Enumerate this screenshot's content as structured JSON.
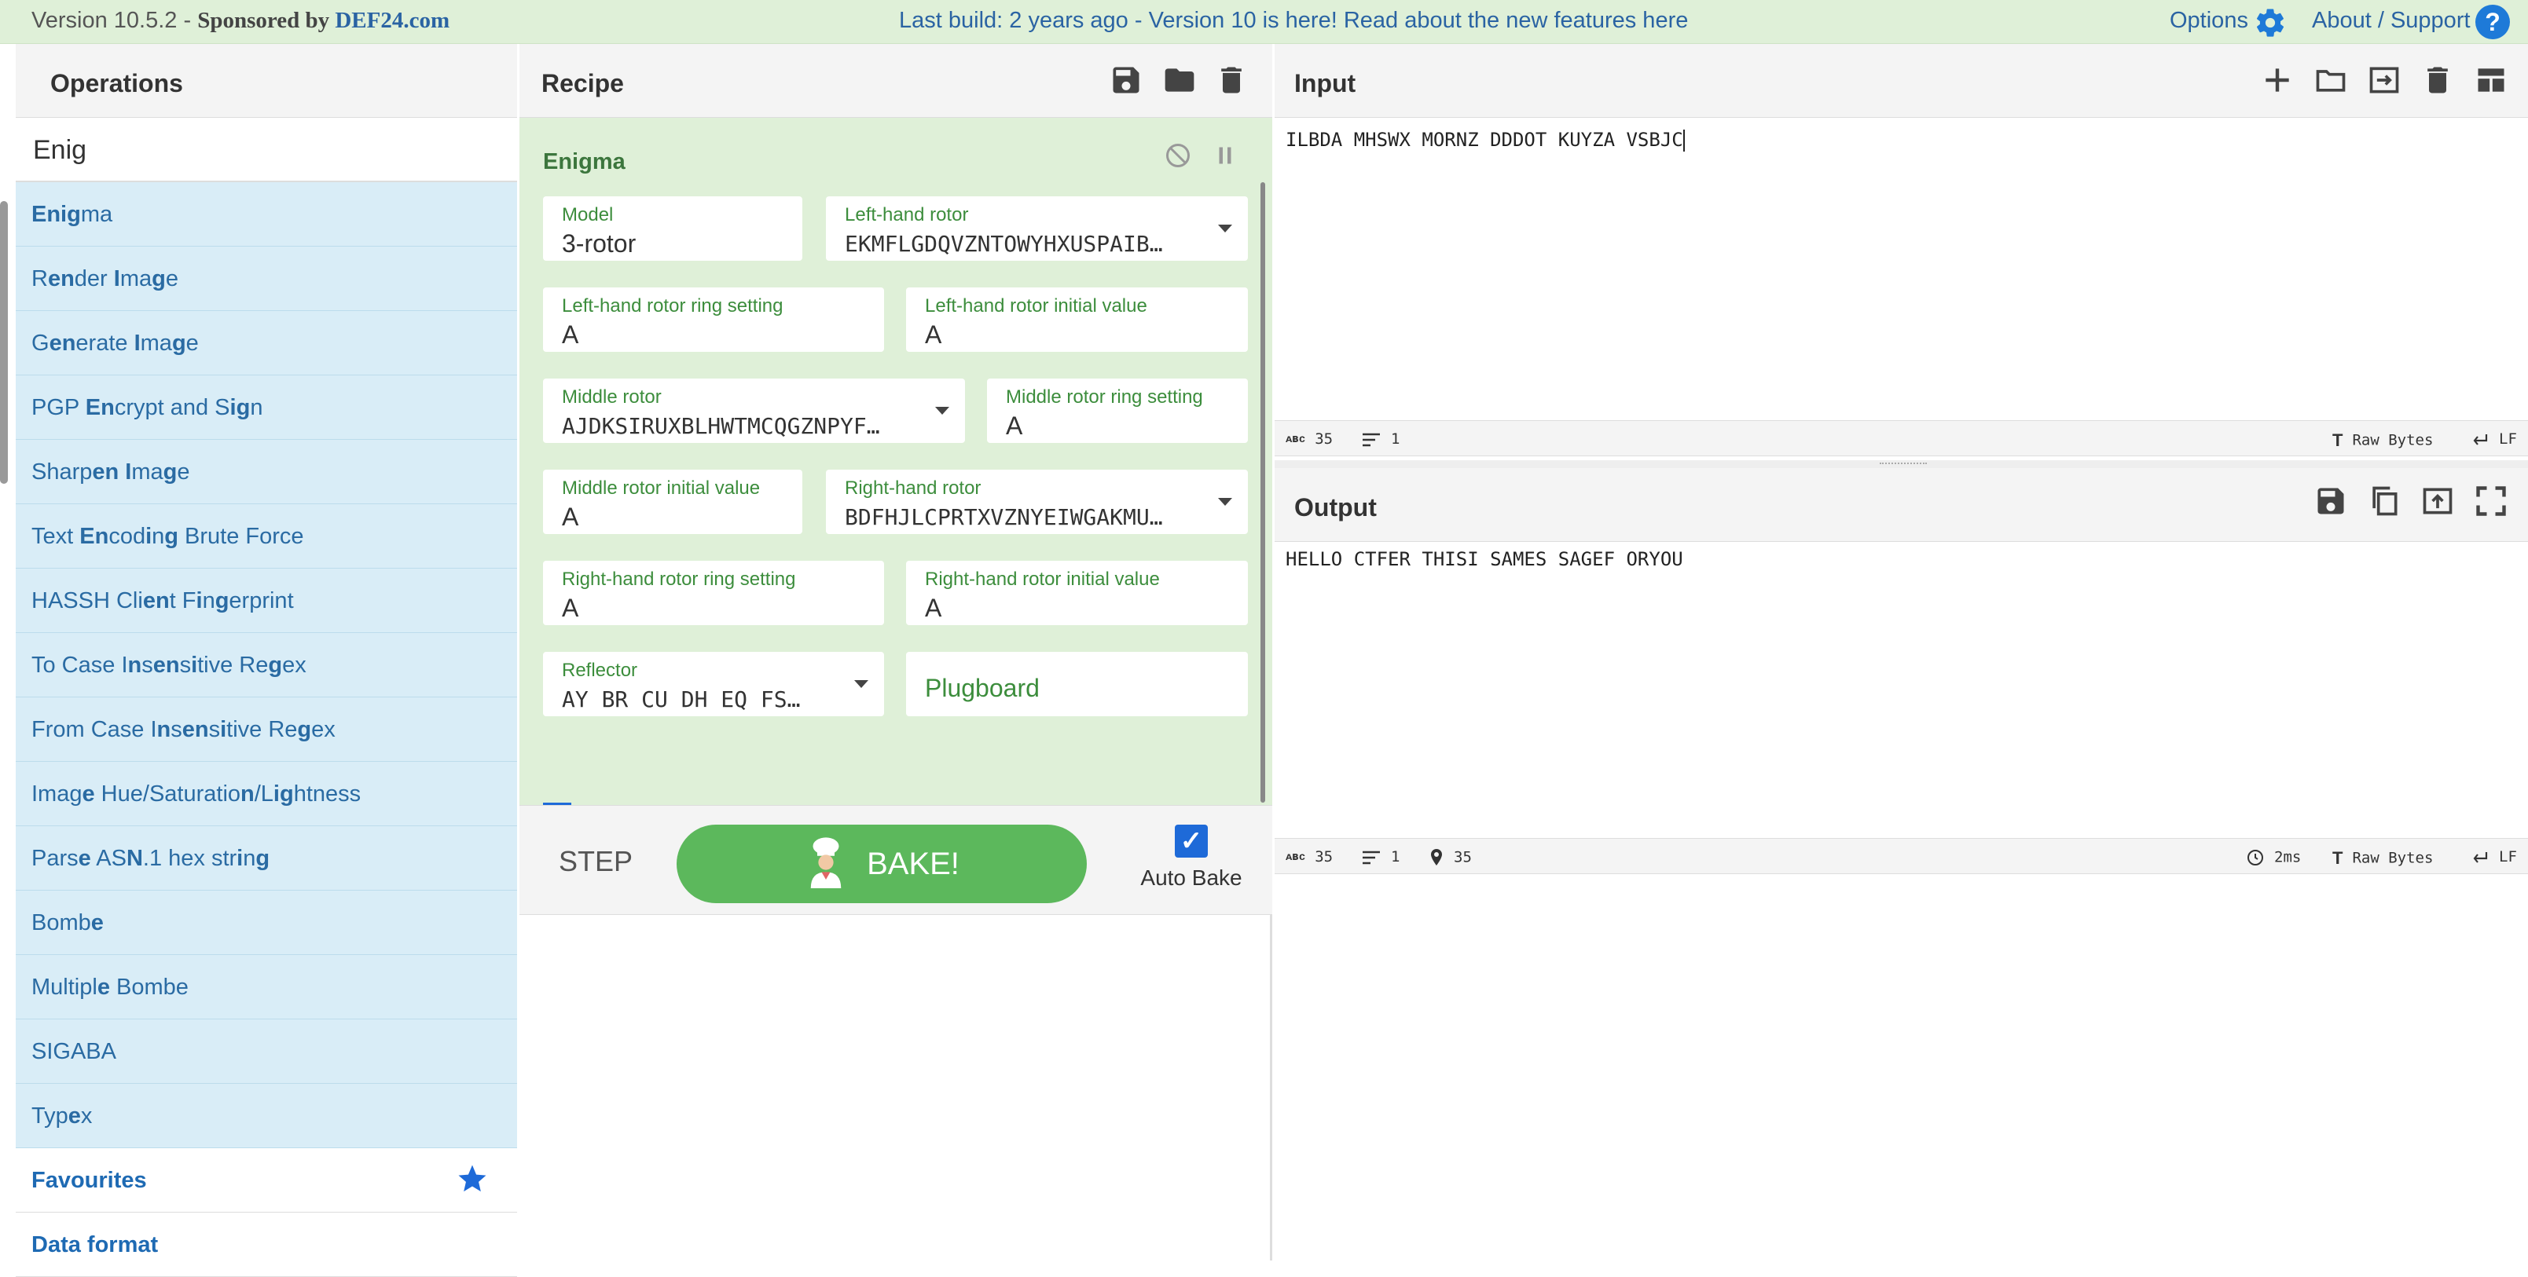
{
  "topbar": {
    "version": "Version 10.5.2 - ",
    "sponsored": "Sponsored",
    "by": " by ",
    "sponsor": "DEF24.com",
    "last_build": "Last build: 2 years ago - Version 10 is here! Read about the new features here",
    "options": "Options",
    "about": "About / Support",
    "help_icon": "?"
  },
  "operations": {
    "title": "Operations",
    "search_value": "Enig",
    "items": [
      {
        "parts": [
          {
            "t": "Enig",
            "b": true
          },
          {
            "t": "ma",
            "b": false
          }
        ]
      },
      {
        "parts": [
          {
            "t": "R",
            "b": false
          },
          {
            "t": "en",
            "b": true
          },
          {
            "t": "der ",
            "b": false
          },
          {
            "t": "I",
            "b": true
          },
          {
            "t": "ma",
            "b": false
          },
          {
            "t": "g",
            "b": true
          },
          {
            "t": "e",
            "b": false
          }
        ]
      },
      {
        "parts": [
          {
            "t": "G",
            "b": false
          },
          {
            "t": "en",
            "b": true
          },
          {
            "t": "erate ",
            "b": false
          },
          {
            "t": "I",
            "b": true
          },
          {
            "t": "ma",
            "b": false
          },
          {
            "t": "g",
            "b": true
          },
          {
            "t": "e",
            "b": false
          }
        ]
      },
      {
        "parts": [
          {
            "t": "PGP ",
            "b": false
          },
          {
            "t": "En",
            "b": true
          },
          {
            "t": "crypt and S",
            "b": false
          },
          {
            "t": "ig",
            "b": true
          },
          {
            "t": "n",
            "b": false
          }
        ]
      },
      {
        "parts": [
          {
            "t": "Sharp",
            "b": false
          },
          {
            "t": "en",
            "b": true
          },
          {
            "t": " ",
            "b": false
          },
          {
            "t": "I",
            "b": true
          },
          {
            "t": "ma",
            "b": false
          },
          {
            "t": "g",
            "b": true
          },
          {
            "t": "e",
            "b": false
          }
        ]
      },
      {
        "parts": [
          {
            "t": "Text ",
            "b": false
          },
          {
            "t": "En",
            "b": true
          },
          {
            "t": "cod",
            "b": false
          },
          {
            "t": "i",
            "b": true
          },
          {
            "t": "n",
            "b": false
          },
          {
            "t": "g",
            "b": true
          },
          {
            "t": " Brute Force",
            "b": false
          }
        ]
      },
      {
        "parts": [
          {
            "t": "HASSH Cli",
            "b": false
          },
          {
            "t": "en",
            "b": true
          },
          {
            "t": "t F",
            "b": false
          },
          {
            "t": "i",
            "b": true
          },
          {
            "t": "n",
            "b": false
          },
          {
            "t": "g",
            "b": true
          },
          {
            "t": "erprint",
            "b": false
          }
        ]
      },
      {
        "parts": [
          {
            "t": "To Case I",
            "b": false
          },
          {
            "t": "n",
            "b": true
          },
          {
            "t": "s",
            "b": false
          },
          {
            "t": "en",
            "b": true
          },
          {
            "t": "s",
            "b": false
          },
          {
            "t": "i",
            "b": true
          },
          {
            "t": "tive Re",
            "b": false
          },
          {
            "t": "g",
            "b": true
          },
          {
            "t": "ex",
            "b": false
          }
        ]
      },
      {
        "parts": [
          {
            "t": "From Case I",
            "b": false
          },
          {
            "t": "n",
            "b": true
          },
          {
            "t": "s",
            "b": false
          },
          {
            "t": "en",
            "b": true
          },
          {
            "t": "s",
            "b": false
          },
          {
            "t": "i",
            "b": true
          },
          {
            "t": "tive Re",
            "b": false
          },
          {
            "t": "g",
            "b": true
          },
          {
            "t": "ex",
            "b": false
          }
        ]
      },
      {
        "parts": [
          {
            "t": "Imag",
            "b": false
          },
          {
            "t": "e",
            "b": true
          },
          {
            "t": " Hue/Saturatio",
            "b": false
          },
          {
            "t": "n",
            "b": true
          },
          {
            "t": "/L",
            "b": false
          },
          {
            "t": "ig",
            "b": true
          },
          {
            "t": "htness",
            "b": false
          }
        ]
      },
      {
        "parts": [
          {
            "t": "Pars",
            "b": false
          },
          {
            "t": "e",
            "b": true
          },
          {
            "t": " AS",
            "b": false
          },
          {
            "t": "N",
            "b": true
          },
          {
            "t": ".1 hex str",
            "b": false
          },
          {
            "t": "i",
            "b": true
          },
          {
            "t": "n",
            "b": false
          },
          {
            "t": "g",
            "b": true
          }
        ]
      },
      {
        "parts": [
          {
            "t": "Bomb",
            "b": false
          },
          {
            "t": "e",
            "b": true
          }
        ]
      },
      {
        "parts": [
          {
            "t": "Multipl",
            "b": false
          },
          {
            "t": "e",
            "b": true
          },
          {
            "t": " Bombe",
            "b": false
          }
        ]
      },
      {
        "parts": [
          {
            "t": "SIGABA",
            "b": false
          }
        ]
      },
      {
        "parts": [
          {
            "t": "Typ",
            "b": false
          },
          {
            "t": "e",
            "b": true
          },
          {
            "t": "x",
            "b": false
          }
        ]
      }
    ],
    "categories": [
      "Favourites",
      "Data format"
    ]
  },
  "recipe": {
    "title": "Recipe",
    "ingredient": "Enigma",
    "fields": {
      "model": {
        "label": "Model",
        "value": "3-rotor"
      },
      "left_rotor": {
        "label": "Left-hand rotor",
        "value": "EKMFLGDQVZNTOWYHXUSPAIB…"
      },
      "left_ring": {
        "label": "Left-hand rotor ring setting",
        "value": "A"
      },
      "left_init": {
        "label": "Left-hand rotor initial value",
        "value": "A"
      },
      "middle_rotor": {
        "label": "Middle rotor",
        "value": "AJDKSIRUXBLHWTMCQGZNPYF…"
      },
      "middle_ring": {
        "label": "Middle rotor ring setting",
        "value": "A"
      },
      "middle_init": {
        "label": "Middle rotor initial value",
        "value": "A"
      },
      "right_rotor": {
        "label": "Right-hand rotor",
        "value": "BDFHJLCPRTXVZNYEIWGAKMU…"
      },
      "right_ring": {
        "label": "Right-hand rotor ring setting",
        "value": "A"
      },
      "right_init": {
        "label": "Right-hand rotor initial value",
        "value": "A"
      },
      "reflector": {
        "label": "Reflector",
        "value": "AY BR CU DH EQ FS…"
      },
      "plugboard": {
        "placeholder": "Plugboard"
      }
    },
    "step_label": "STEP",
    "bake_label": "BAKE!",
    "autobake_label": "Auto Bake",
    "autobake_check": "✓"
  },
  "input": {
    "title": "Input",
    "text": "ILBDA MHSWX MORNZ DDDOT KUYZA VSBJC",
    "status": {
      "length": "35",
      "lines": "1",
      "encoding": "Raw Bytes",
      "eol": "LF"
    }
  },
  "output": {
    "title": "Output",
    "text": "HELLO CTFER THISI SAMES SAGEF ORYOU",
    "status": {
      "length": "35",
      "lines": "1",
      "position": "35",
      "time": "2ms",
      "encoding": "Raw Bytes",
      "eol": "LF"
    }
  },
  "icons": {
    "abc": "ᴀʙᴄ"
  }
}
